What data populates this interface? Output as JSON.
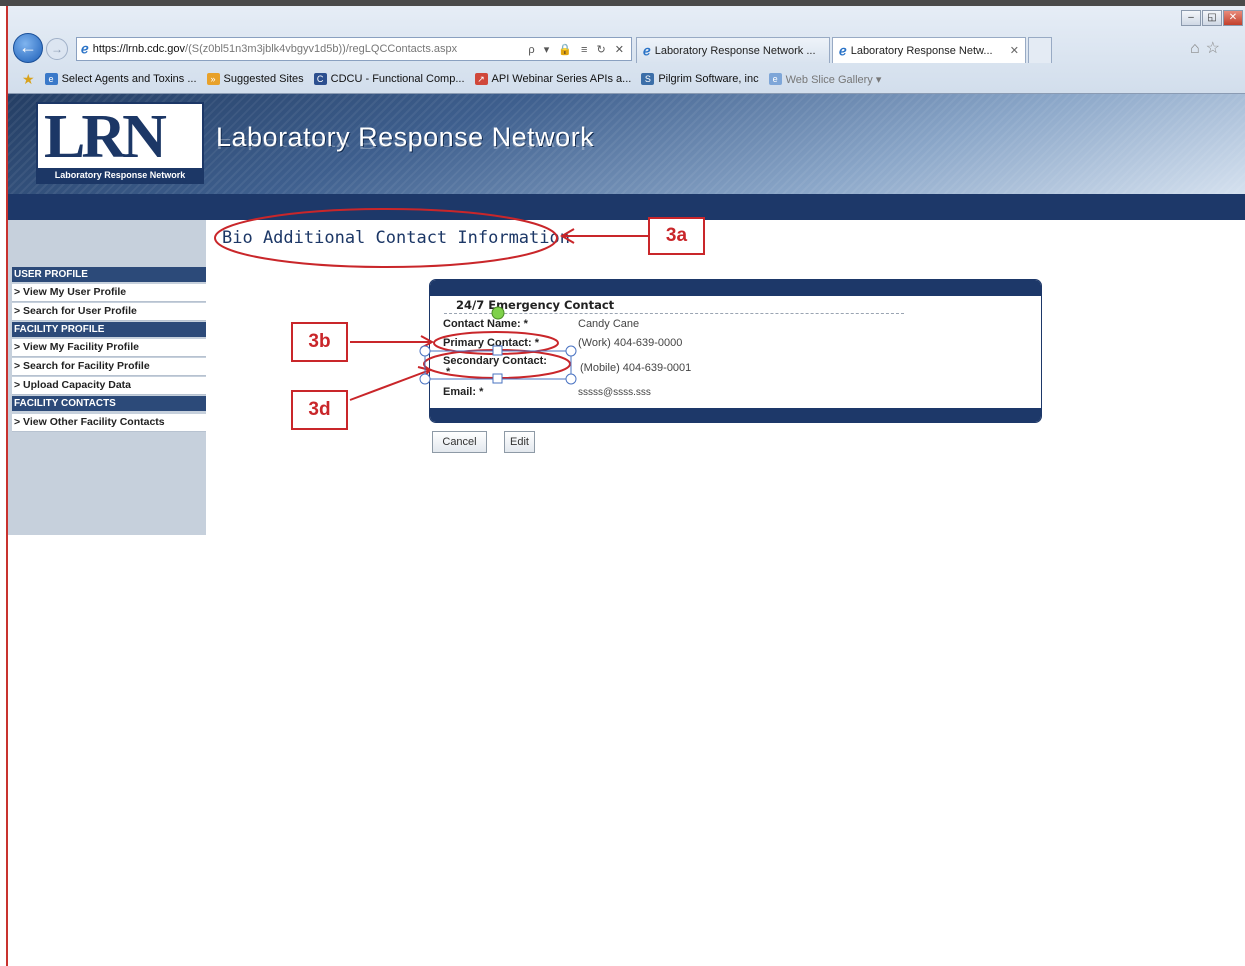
{
  "browser": {
    "url_domain": "https://lrnb.cdc.gov",
    "url_rest": "/(S(z0bl51n3m3jblk4vbgyv1d5b))/regLQCContacts.aspx",
    "address_controls": "ρ ▾ 🔒 ≡ ↻ ✕",
    "tabs": [
      {
        "label": "Laboratory Response Network ..."
      },
      {
        "label": "Laboratory Response Netw...",
        "close": "✕"
      }
    ],
    "favorites": [
      {
        "label": "Select Agents and Toxins ..."
      },
      {
        "label": "Suggested Sites"
      },
      {
        "label": "CDCU - Functional Comp..."
      },
      {
        "label": "API Webinar Series APIs a..."
      },
      {
        "label": "Pilgrim Software, inc"
      },
      {
        "label": "Web Slice Gallery ▾"
      }
    ],
    "window_controls": [
      "–",
      "◱",
      "✕"
    ]
  },
  "site": {
    "logo_text": "LRN",
    "logo_subtitle": "Laboratory Response Network",
    "title": "Laboratory Response Network"
  },
  "sidebar": {
    "sections": [
      {
        "header": "USER PROFILE",
        "items": [
          "> View My User Profile",
          "> Search for User Profile"
        ]
      },
      {
        "header": "FACILITY PROFILE",
        "items": [
          "> View My Facility Profile",
          "> Search for Facility Profile",
          "> Upload Capacity Data"
        ]
      },
      {
        "header": "FACILITY CONTACTS",
        "items": [
          "> View Other Facility Contacts"
        ]
      }
    ]
  },
  "main": {
    "page_title": "Bio Additional Contact Information",
    "card": {
      "subtitle": "24/7 Emergency Contact",
      "fields": [
        {
          "label": "Contact Name: *",
          "value": "Candy Cane"
        },
        {
          "label": "Primary Contact: *",
          "value": "(Work) 404-639-0000"
        },
        {
          "label": "Secondary Contact:",
          "label2": "*",
          "value": "(Mobile) 404-639-0001"
        },
        {
          "label": "Email: *",
          "value": "sssss@ssss.sss"
        }
      ]
    },
    "buttons": {
      "cancel": "Cancel",
      "edit": "Edit"
    }
  },
  "annotations": {
    "callouts": [
      "3a",
      "3b",
      "3d"
    ],
    "color": "#c9262a"
  },
  "colors": {
    "navy": "#1d3869",
    "sidebar_bg": "#c6d0dc",
    "annotation_red": "#c9262a"
  }
}
